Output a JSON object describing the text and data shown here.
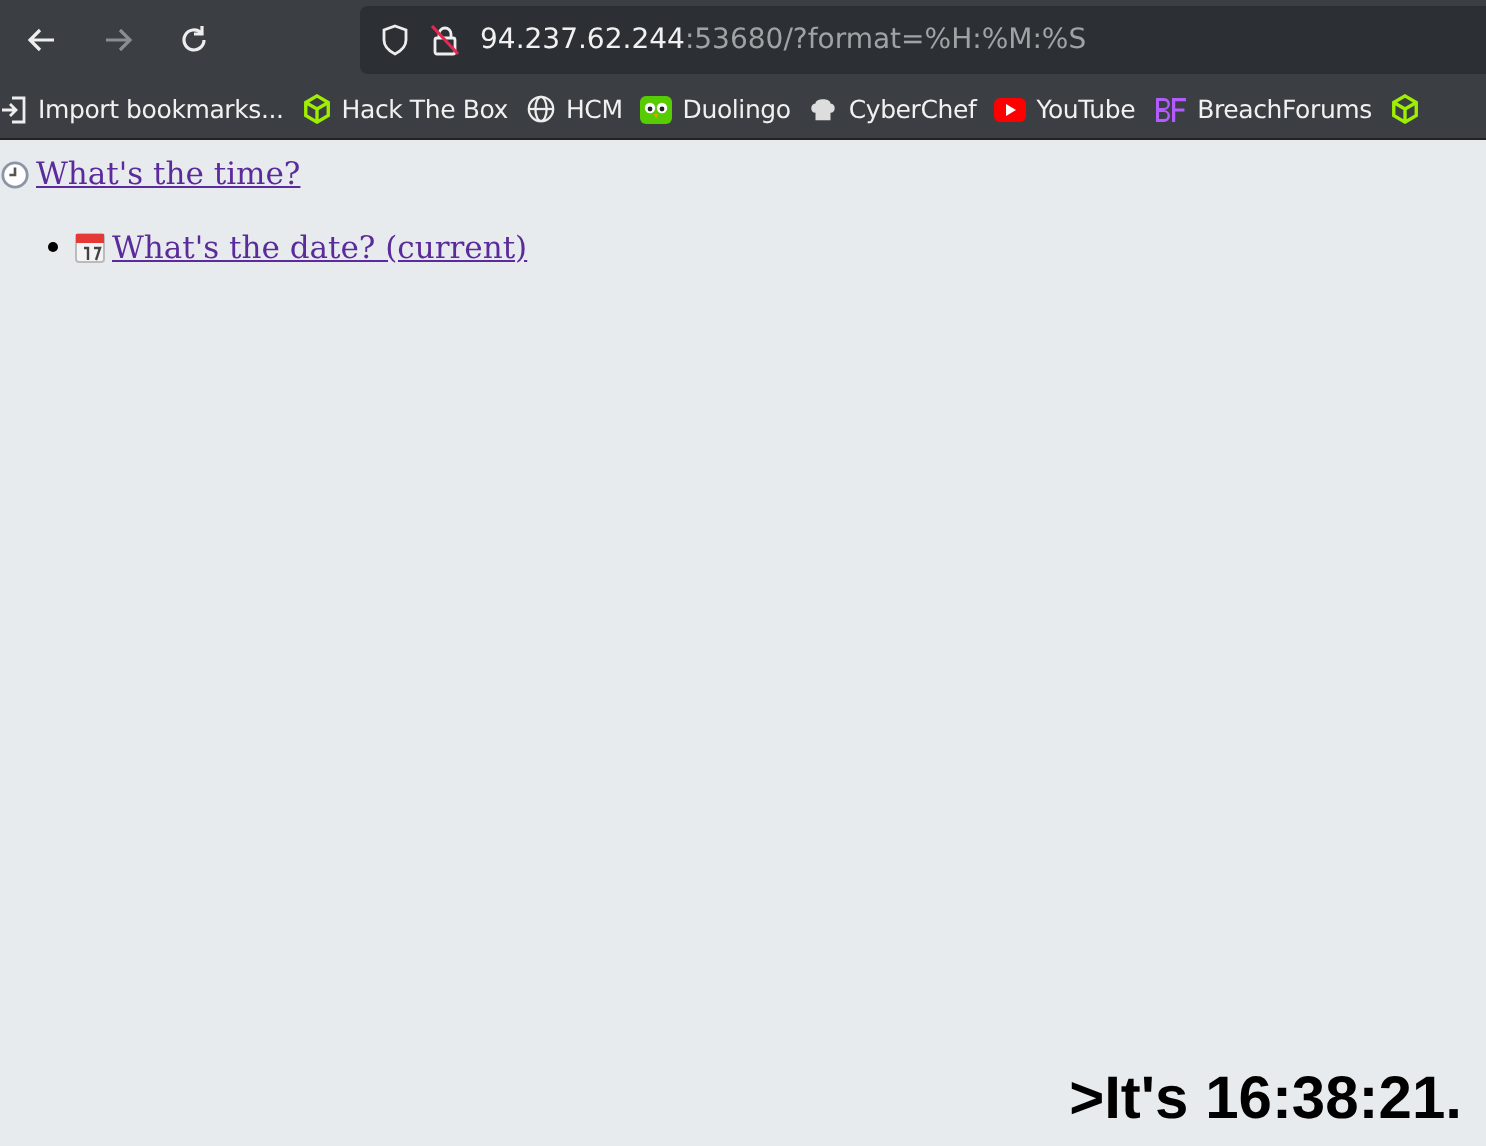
{
  "toolbar": {
    "back_enabled": true,
    "forward_enabled": false,
    "url_host": "94.237.62.244",
    "url_rest": ":53680/?format=%H:%M:%S"
  },
  "bookmarks": [
    {
      "kind": "import",
      "label": "Import bookmarks..."
    },
    {
      "kind": "cube",
      "label": "Hack The Box"
    },
    {
      "kind": "globe",
      "label": "HCM"
    },
    {
      "kind": "owl",
      "label": "Duolingo"
    },
    {
      "kind": "chef",
      "label": "CyberChef"
    },
    {
      "kind": "play",
      "label": "YouTube"
    },
    {
      "kind": "bf",
      "label": "BreachForums"
    },
    {
      "kind": "cube"
    }
  ],
  "page": {
    "link": "What's the time?",
    "list": [
      "What's the date? (current)"
    ],
    "output": ">It's 16:38:21."
  }
}
